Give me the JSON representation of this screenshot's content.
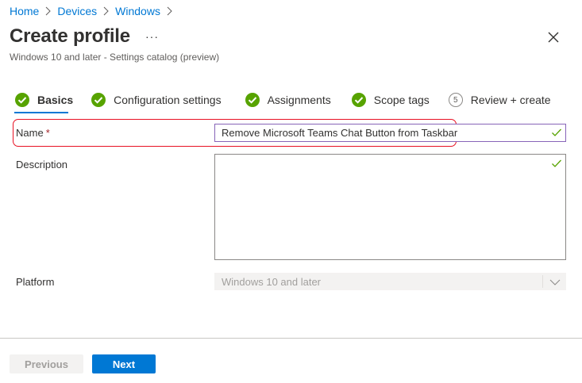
{
  "breadcrumb": [
    "Home",
    "Devices",
    "Windows"
  ],
  "header": {
    "title": "Create profile",
    "more_label": "···",
    "subtitle": "Windows 10 and later - Settings catalog (preview)"
  },
  "steps": [
    {
      "label": "Basics",
      "status": "complete",
      "active": true
    },
    {
      "label": "Configuration settings",
      "status": "complete"
    },
    {
      "label": "Assignments",
      "status": "complete"
    },
    {
      "label": "Scope tags",
      "status": "complete"
    },
    {
      "label": "Review + create",
      "status": "pending",
      "number": "5"
    }
  ],
  "form": {
    "name_label": "Name",
    "required_mark": "*",
    "name_value": "Remove Microsoft Teams Chat Button from Taskbar",
    "description_label": "Description",
    "description_value": "",
    "platform_label": "Platform",
    "platform_value": "Windows 10 and later"
  },
  "footer": {
    "previous_label": "Previous",
    "next_label": "Next"
  },
  "colors": {
    "accent": "#0078d4",
    "success": "#57a300",
    "highlight": "#e81123"
  }
}
